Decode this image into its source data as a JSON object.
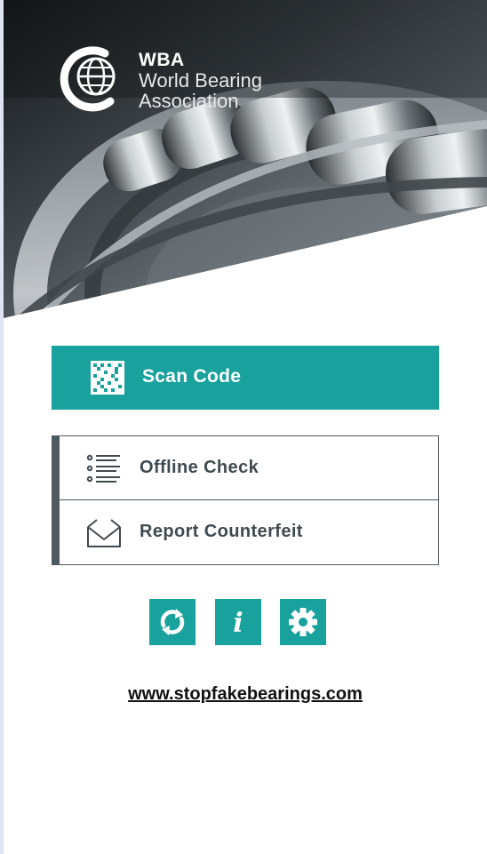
{
  "brand": {
    "abbr": "WBA",
    "name_line1": "World Bearing",
    "name_line2": "Association",
    "accent_color": "#18a19d",
    "dark_color": "#4f5a60"
  },
  "actions": {
    "scan_label": "Scan Code",
    "scan_icon": "qr-code-icon"
  },
  "menu": {
    "items": [
      {
        "label": "Offline Check",
        "icon": "list-icon"
      },
      {
        "label": "Report Counterfeit",
        "icon": "envelope-icon"
      }
    ]
  },
  "toolbar": {
    "refresh_icon": "refresh-icon",
    "info_label": "i",
    "settings_icon": "gear-icon"
  },
  "footer": {
    "link_text": "www.stopfakebearings.com"
  }
}
